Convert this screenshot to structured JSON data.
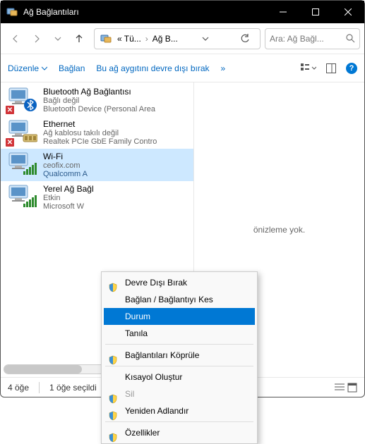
{
  "window": {
    "title": "Ağ Bağlantıları"
  },
  "nav": {
    "path1": "« Tü...",
    "path2": "Ağ B...",
    "search_placeholder": "Ara: Ağ Bağl..."
  },
  "toolbar": {
    "organize": "Düzenle",
    "connect": "Bağlan",
    "disable": "Bu ağ aygıtını devre dışı bırak",
    "more": "»"
  },
  "items": [
    {
      "name": "Bluetooth Ağ Bağlantısı",
      "status": "Bağlı değil",
      "device": "Bluetooth Device (Personal Area",
      "error": true,
      "type": "bt"
    },
    {
      "name": "Ethernet",
      "status": "Ağ kablosu takılı değil",
      "device": "Realtek PCIe GbE Family Contro",
      "error": true,
      "type": "eth"
    },
    {
      "name": "Wi-Fi",
      "status": "ceofix.com",
      "device": "Qualcomm A",
      "selected": true,
      "type": "wifi"
    },
    {
      "name": "Yerel Ağ Bağl",
      "status": "Etkin",
      "device": "Microsoft W",
      "type": "wifi"
    }
  ],
  "preview": {
    "empty": "önizleme yok."
  },
  "context_menu": {
    "items": [
      {
        "label": "Devre Dışı Bırak",
        "shield": true
      },
      {
        "label": "Bağlan / Bağlantıyı Kes"
      },
      {
        "label": "Durum",
        "hovered": true
      },
      {
        "label": "Tanıla"
      },
      {
        "sep": true
      },
      {
        "label": "Bağlantıları Köprüle",
        "shield": true
      },
      {
        "sep": true
      },
      {
        "label": "Kısayol Oluştur"
      },
      {
        "label": "Sil",
        "shield": true,
        "disabled": true
      },
      {
        "label": "Yeniden Adlandır",
        "shield": true
      },
      {
        "sep": true
      },
      {
        "label": "Özellikler",
        "shield": true
      }
    ]
  },
  "status": {
    "count": "4 öğe",
    "selected": "1 öğe seçildi"
  }
}
